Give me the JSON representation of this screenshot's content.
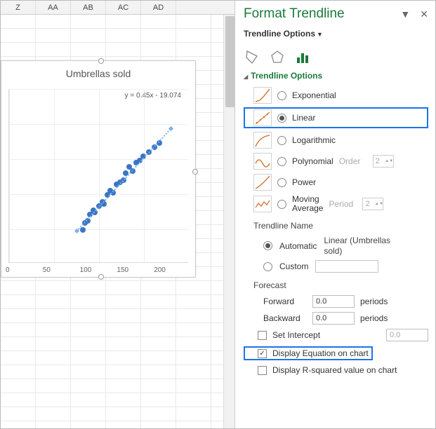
{
  "columns": [
    "Z",
    "AA",
    "AB",
    "AC",
    "AD"
  ],
  "chart": {
    "title": "Umbrellas sold",
    "equation": "y = 0.45x - 19.074",
    "xticks": [
      "0",
      "50",
      "100",
      "150",
      "200"
    ]
  },
  "chart_data": {
    "type": "scatter",
    "title": "Umbrellas sold",
    "xlabel": "",
    "ylabel": "",
    "xlim": [
      0,
      200
    ],
    "ylim": [
      0,
      80
    ],
    "series": [
      {
        "name": "Umbrellas sold",
        "points": [
          [
            82,
            15
          ],
          [
            85,
            18
          ],
          [
            88,
            19
          ],
          [
            90,
            22
          ],
          [
            94,
            24
          ],
          [
            96,
            23
          ],
          [
            100,
            26
          ],
          [
            104,
            28
          ],
          [
            106,
            27
          ],
          [
            110,
            31
          ],
          [
            113,
            33
          ],
          [
            116,
            32
          ],
          [
            120,
            36
          ],
          [
            124,
            37
          ],
          [
            128,
            38
          ],
          [
            130,
            41
          ],
          [
            134,
            44
          ],
          [
            138,
            42
          ],
          [
            142,
            46
          ],
          [
            146,
            47
          ],
          [
            150,
            49
          ],
          [
            156,
            51
          ],
          [
            162,
            53
          ],
          [
            168,
            55
          ]
        ]
      }
    ],
    "trendline": {
      "type": "linear",
      "equation": "y = 0.45x - 19.074"
    }
  },
  "panel": {
    "title": "Format Trendline",
    "dropdown": "Trendline Options",
    "section": "Trendline Options",
    "types": {
      "exponential": "Exponential",
      "linear": "Linear",
      "logarithmic": "Logarithmic",
      "polynomial": "Polynomial",
      "power": "Power",
      "moving_average": "Moving\nAverage"
    },
    "poly": {
      "order_label": "Order",
      "order_value": "2"
    },
    "ma": {
      "period_label": "Period",
      "period_value": "2"
    },
    "name": {
      "heading": "Trendline Name",
      "automatic": "Automatic",
      "custom": "Custom",
      "readout": "Linear (Umbrellas sold)"
    },
    "forecast": {
      "heading": "Forecast",
      "forward": "Forward",
      "backward": "Backward",
      "forward_val": "0.0",
      "backward_val": "0.0",
      "unit": "periods"
    },
    "checks": {
      "intercept": "Set Intercept",
      "intercept_val": "0.0",
      "equation": "Display Equation on chart",
      "rsquared": "Display R-squared value on chart"
    }
  }
}
